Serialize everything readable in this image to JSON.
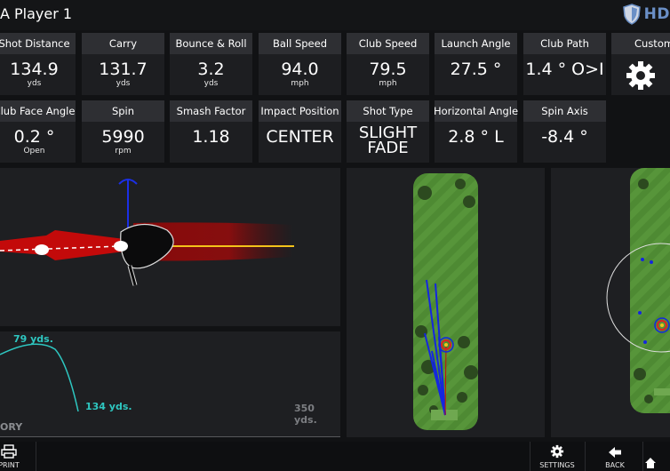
{
  "header": {
    "player_title": "A   Player 1",
    "brand": "HD"
  },
  "tiles_row1": [
    {
      "label": "Shot Distance",
      "value": "134.9",
      "unit": "yds"
    },
    {
      "label": "Carry",
      "value": "131.7",
      "unit": "yds"
    },
    {
      "label": "Bounce & Roll",
      "value": "3.2",
      "unit": "yds"
    },
    {
      "label": "Ball Speed",
      "value": "94.0",
      "unit": "mph"
    },
    {
      "label": "Club Speed",
      "value": "79.5",
      "unit": "mph"
    },
    {
      "label": "Launch Angle",
      "value": "27.5 °",
      "unit": ""
    },
    {
      "label": "Club Path",
      "value": "1.4 ° O>I",
      "unit": ""
    },
    {
      "label": "Customize",
      "value": "",
      "unit": ""
    }
  ],
  "tiles_row2": [
    {
      "label": "Club Face Angle",
      "value": "0.2 °",
      "unit": "Open"
    },
    {
      "label": "Spin",
      "value": "5990",
      "unit": "rpm"
    },
    {
      "label": "Smash Factor",
      "value": "1.18",
      "unit": ""
    },
    {
      "label": "Impact Position",
      "value": "CENTER",
      "unit": ""
    },
    {
      "label": "Shot Type",
      "value": "SLIGHT FADE",
      "unit": ""
    },
    {
      "label": "Horizontal Angle",
      "value": "2.8 °  L",
      "unit": ""
    },
    {
      "label": "Spin Axis",
      "value": "-8.4 °",
      "unit": ""
    }
  ],
  "trajectory": {
    "peak_label": "79 yds.",
    "end_label": "134 yds.",
    "range_label": "350 yds.",
    "title": "ORY"
  },
  "bottom": {
    "print": "PRINT",
    "settings": "SETTINGS",
    "back": "BACK"
  },
  "colors": {
    "accent_teal": "#2ec7c1",
    "fairway": "#4f8a33",
    "shot_line": "#1426e0",
    "club_path": "#c80a0a"
  },
  "icons": [
    "shield-logo-icon",
    "gear-icon",
    "printer-icon",
    "back-arrow-icon"
  ]
}
